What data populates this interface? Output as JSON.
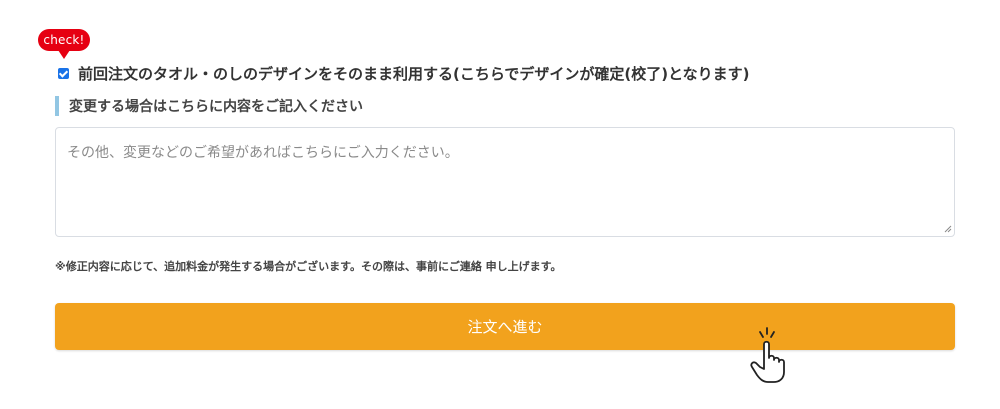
{
  "badge": {
    "label": "check!",
    "color": "#e60012"
  },
  "design_option": {
    "checked": true,
    "label": "前回注文のタオル・のしのデザインをそのまま利用する(こちらでデザインが確定(校了)となります)",
    "checkbox_color": "#1a73e8"
  },
  "change_section": {
    "heading": "変更する場合はこちらに内容をご記入ください",
    "accent_color": "#92c6e3",
    "textarea_value": "",
    "textarea_placeholder": "その他、変更などのご希望があればこちらにご入力ください。"
  },
  "note": "※修正内容に応じて、追加料金が発生する場合がございます。その際は、事前にご連絡 申し上げます。",
  "order_button": {
    "label": "注文へ進む",
    "color": "#f2a21d"
  },
  "icons": {
    "checkbox": "checkbox-checked-icon",
    "pointer": "hand-pointer-icon",
    "resize": "resize-handle-icon"
  }
}
